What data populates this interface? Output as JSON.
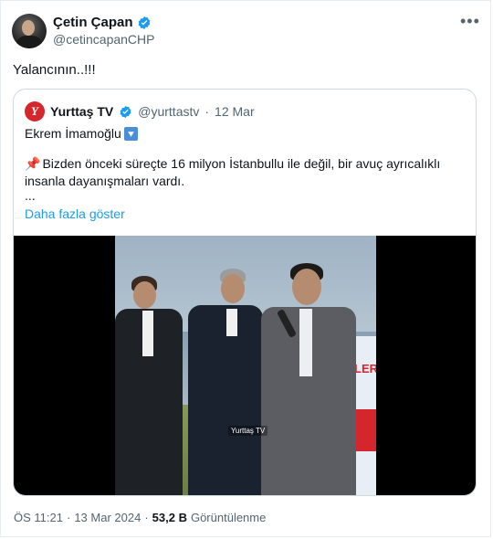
{
  "author": {
    "display_name": "Çetin Çapan",
    "handle": "@cetincapanCHP"
  },
  "tweet": {
    "text": "Yalancının..!!!"
  },
  "quoted": {
    "display_name": "Yurttaş TV",
    "handle": "@yurttastv",
    "separator": "·",
    "date": "12 Mar",
    "line1": "Ekrem İmamoğlu",
    "body": "Bizden önceki süreçte 16 milyon İstanbullu ile değil, bir avuç ayrıcalıklı insanla dayanışmaları vardı.",
    "ellipsis": "...",
    "show_more": "Daha fazla göster",
    "video": {
      "banner_text": "LER",
      "watermark": "Yurttaş TV"
    }
  },
  "footer": {
    "time": "ÖS 11:21",
    "separator": "·",
    "date": "13 Mar 2024",
    "views": "53,2 B",
    "views_label": "Görüntülenme"
  },
  "colors": {
    "verified": "#1d9bf0",
    "link": "#1d9bf0",
    "brand_red": "#d6262d"
  }
}
